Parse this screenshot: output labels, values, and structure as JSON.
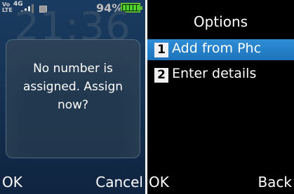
{
  "left_screen": {
    "status_bar": {
      "volte_label": "Vo LTE",
      "network_label": "4G",
      "battery_percent_text": "94%",
      "battery_level": 0.94,
      "icons": [
        "volte-icon",
        "signal-icon",
        "sim-icon",
        "battery-icon"
      ]
    },
    "background_clock": "21:36",
    "dialog": {
      "message": "No number is assigned. Assign now?"
    },
    "softkeys": {
      "left": "OK",
      "right": "Cancel"
    }
  },
  "right_screen": {
    "title": "Options",
    "items": [
      {
        "number": "1",
        "label": "Add from Phc",
        "selected": true
      },
      {
        "number": "2",
        "label": "Enter details",
        "selected": false
      }
    ],
    "softkeys": {
      "left": "OK",
      "right": "Back"
    }
  },
  "colors": {
    "left_background": "#163455",
    "selected_item": "#2384c9",
    "battery_green": "#4cd42a"
  }
}
